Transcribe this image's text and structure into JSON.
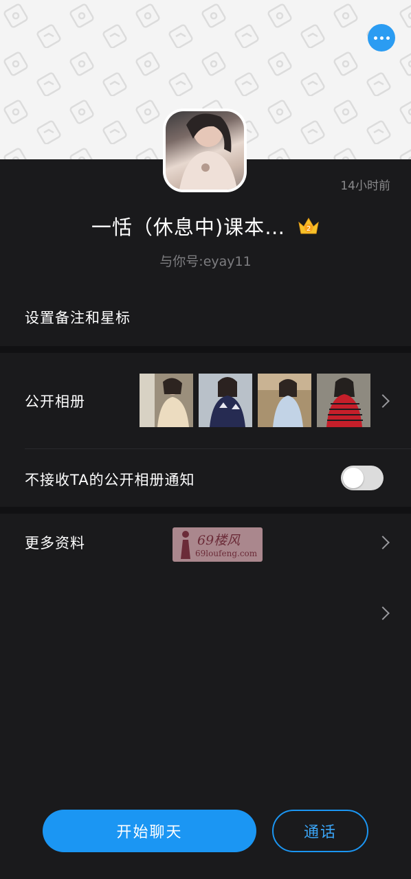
{
  "header": {
    "time_ago": "14小时前",
    "more_icon": "more-dots-icon",
    "accent": "#1b96f3"
  },
  "profile": {
    "name": "一恬（休息中)课本…",
    "badge_level": "2",
    "sub": "与你号:eyay11"
  },
  "settings": {
    "remark_label": "设置备注和星标",
    "album_label": "公开相册",
    "notify_label": "不接收TA的公开相册通知",
    "notify_on": false,
    "more_label": "更多资料"
  },
  "watermark": {
    "title": "69楼风",
    "url": "69loufeng.com"
  },
  "actions": {
    "chat_label": "开始聊天",
    "call_label": "通话"
  }
}
